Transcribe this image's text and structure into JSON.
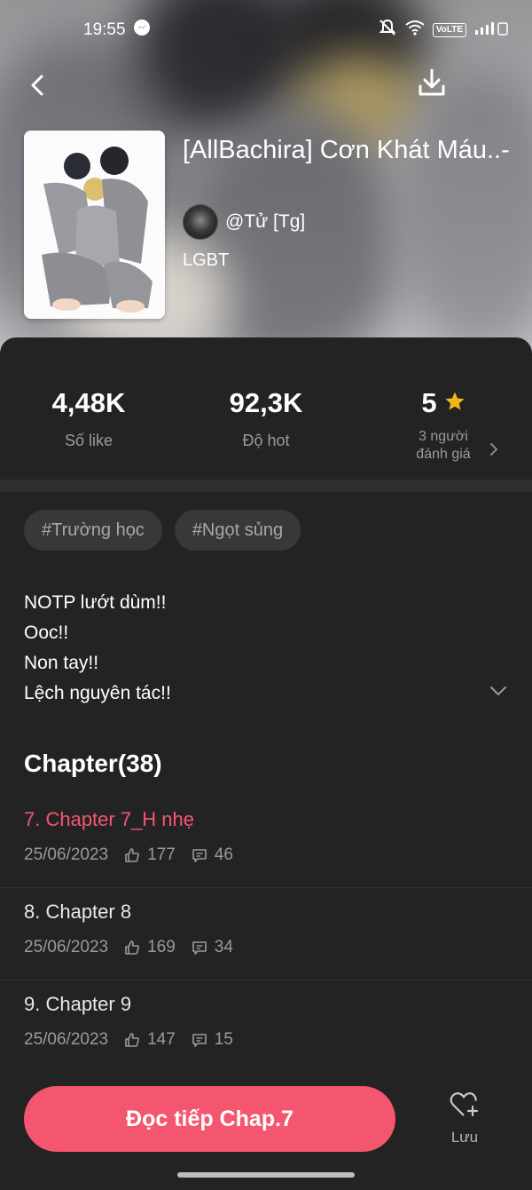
{
  "status_bar": {
    "time": "19:55",
    "icons": [
      "messenger-icon",
      "mute-icon",
      "wifi-icon",
      "volte-icon",
      "signal-icon"
    ],
    "volte_label": "VoLTE"
  },
  "header": {
    "back_icon": "chevron-left-icon",
    "download_icon": "download-icon"
  },
  "story": {
    "title": "[AllBachira] Cơn Khát Máu..-",
    "author": "@Tử [Tg]",
    "category": "LGBT"
  },
  "stats": {
    "likes": {
      "value": "4,48K",
      "label": "Số like"
    },
    "hot": {
      "value": "92,3K",
      "label": "Độ hot"
    },
    "rating": {
      "value": "5",
      "label_line1": "3 người",
      "label_line2": "đánh giá",
      "star_color": "#f5b70f"
    }
  },
  "tags": [
    "#Trường học",
    "#Ngọt sủng"
  ],
  "description": [
    "NOTP lướt dùm!!",
    "Ooc!!",
    "Non tay!!",
    "Lệch nguyên tác!!"
  ],
  "chapters_heading": "Chapter(38)",
  "chapters": [
    {
      "title": "7. Chapter 7_H nhẹ",
      "date": "25/06/2023",
      "likes": "177",
      "comments": "46",
      "active": true
    },
    {
      "title": "8. Chapter 8",
      "date": "25/06/2023",
      "likes": "169",
      "comments": "34",
      "active": false
    },
    {
      "title": "9. Chapter 9",
      "date": "25/06/2023",
      "likes": "147",
      "comments": "15",
      "active": false
    }
  ],
  "bottom": {
    "read_label": "Đọc tiếp Chap.7",
    "save_label": "Lưu"
  },
  "colors": {
    "accent": "#f4566f",
    "background": "#232323",
    "muted": "#9a9a9a"
  }
}
